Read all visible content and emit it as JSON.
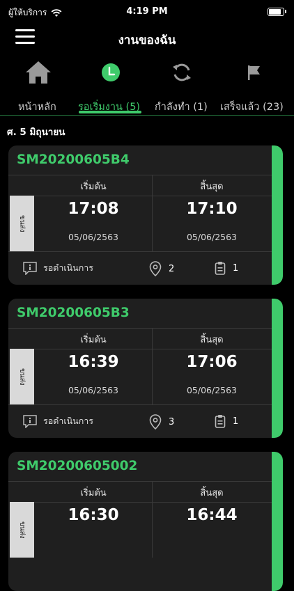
{
  "status_bar": {
    "carrier": "ผู้ให้บริการ",
    "time": "4:19 PM"
  },
  "header": {
    "title": "งานของฉัน"
  },
  "tabs": [
    {
      "label": "หน้าหลัก",
      "icon": "home-icon"
    },
    {
      "label": "รอเริ่มงาน (5)",
      "icon": "clock-icon",
      "active": true
    },
    {
      "label": "กำลังทำ (1)",
      "icon": "refresh-icon"
    },
    {
      "label": "เสร็จแล้ว (23)",
      "icon": "flag-icon"
    }
  ],
  "section_date": "ศ. 5 มิถุนายน",
  "colors": {
    "accent": "#3fcb6b",
    "card_bg": "#1f1f1f",
    "background": "#000000"
  },
  "jobs": [
    {
      "code": "SM20200605B4",
      "side_label": "ขนส่ง",
      "start_label": "เริ่มต้น",
      "start_time": "17:08",
      "start_date": "05/06/2563",
      "end_label": "สิ้นสุด",
      "end_time": "17:10",
      "end_date": "05/06/2563",
      "status": "รอดำเนินการ",
      "locations": "2",
      "documents": "1"
    },
    {
      "code": "SM20200605B3",
      "side_label": "ขนส่ง",
      "start_label": "เริ่มต้น",
      "start_time": "16:39",
      "start_date": "05/06/2563",
      "end_label": "สิ้นสุด",
      "end_time": "17:06",
      "end_date": "05/06/2563",
      "status": "รอดำเนินการ",
      "locations": "3",
      "documents": "1"
    },
    {
      "code": "SM20200605002",
      "side_label": "ขนส่ง",
      "start_label": "เริ่มต้น",
      "start_time": "16:30",
      "start_date": "",
      "end_label": "สิ้นสุด",
      "end_time": "16:44",
      "end_date": "",
      "status": "",
      "locations": "",
      "documents": ""
    }
  ]
}
